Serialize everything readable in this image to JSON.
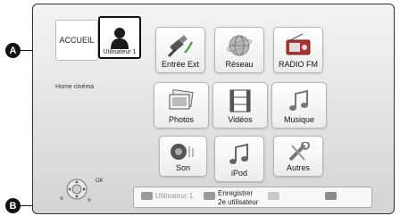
{
  "callouts": {
    "a": "A",
    "b": "B"
  },
  "header": {
    "accueil_label": "ACCUEIL",
    "user_label": "Utilisateur 1",
    "home_label": "Home cinéma"
  },
  "menu": {
    "tiles": [
      {
        "label": "Entrée Ext",
        "icon": "hdmi-plug-icon"
      },
      {
        "label": "Réseau",
        "icon": "globe-network-icon"
      },
      {
        "label": "RADIO FM",
        "icon": "radio-icon"
      },
      {
        "label": "Photos",
        "icon": "photos-icon"
      },
      {
        "label": "Vidéos",
        "icon": "film-icon"
      },
      {
        "label": "Musique",
        "icon": "music-note-icon"
      },
      {
        "label": "Son",
        "icon": "speaker-icon"
      },
      {
        "label": "iPod",
        "icon": "ipod-note-icon"
      },
      {
        "label": "Autres",
        "icon": "wrench-icon"
      }
    ]
  },
  "remote": {
    "ok_label": "OK"
  },
  "bottom_bar": {
    "red_label": "Utilisateur 1",
    "green_label_line1": "Enregistrer",
    "green_label_line2": "2e utilisateur",
    "colors": {
      "red": "#9a9a9a",
      "green": "#9a9a9a",
      "yellow": "#c8c8c8",
      "blue": "#8a8a8a"
    }
  }
}
